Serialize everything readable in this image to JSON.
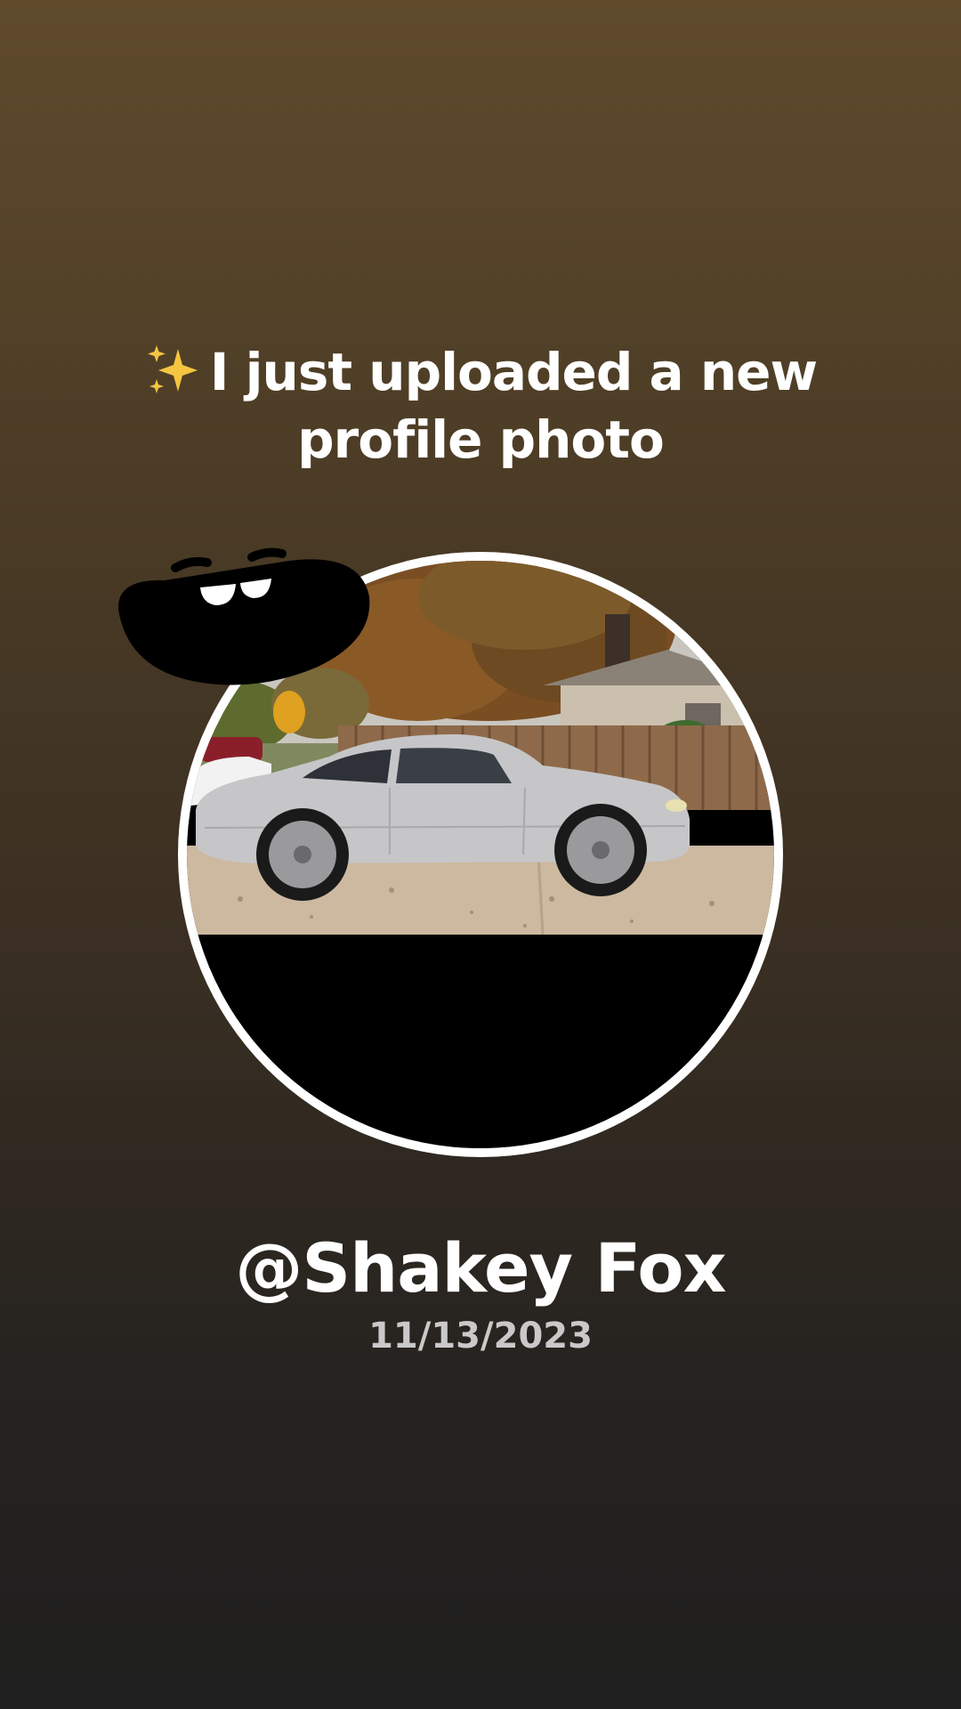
{
  "post": {
    "headline_icon": "sparkles-icon",
    "headline_line1": "I just uploaded a new",
    "headline_line2": "profile photo",
    "username": "@Shakey Fox",
    "date": "11/13/2023"
  },
  "avatar": {
    "image_subject": "silver coupe car parked in driveway",
    "sticker_icon": "laughing-mouth-sticker-icon"
  },
  "colors": {
    "background_top": "#5f4a2c",
    "background_bottom": "#1f1f1f",
    "text_primary": "#ffffff",
    "text_secondary": "#c9c9c9",
    "avatar_ring": "#ffffff",
    "sparkle": "#f5c542"
  }
}
